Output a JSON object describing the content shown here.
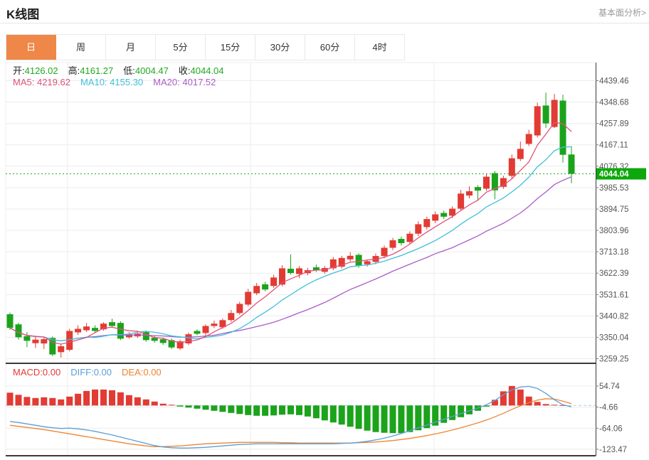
{
  "header": {
    "title": "K线图",
    "link": "基本面分析>"
  },
  "tabs": {
    "items": [
      {
        "name": "tab-day",
        "label": "日",
        "active": true
      },
      {
        "name": "tab-week",
        "label": "周",
        "active": false
      },
      {
        "name": "tab-month",
        "label": "月",
        "active": false
      },
      {
        "name": "tab-5min",
        "label": "5分",
        "active": false
      },
      {
        "name": "tab-15min",
        "label": "15分",
        "active": false
      },
      {
        "name": "tab-30min",
        "label": "30分",
        "active": false
      },
      {
        "name": "tab-60min",
        "label": "60分",
        "active": false
      },
      {
        "name": "tab-4hour",
        "label": "4时",
        "active": false
      }
    ]
  },
  "ohlc": {
    "open_label": "开:",
    "open": "4126.02",
    "high_label": "高:",
    "high": "4161.27",
    "low_label": "低:",
    "low": "4004.47",
    "close_label": "收:",
    "close": "4044.04"
  },
  "ma_info": {
    "ma5_label": "MA5:",
    "ma5": "4219.62",
    "ma10_label": "MA10:",
    "ma10": "4155.30",
    "ma20_label": "MA20:",
    "ma20": "4017.52"
  },
  "macd_info": {
    "macd_label": "MACD:",
    "macd": "0.00",
    "diff_label": "DIFF:",
    "diff": "0.00",
    "dea_label": "DEA:",
    "dea": "0.00"
  },
  "colors": {
    "up": "#e23b33",
    "down": "#1ba31b",
    "ma5": "#e0527a",
    "ma10": "#3fc0d8",
    "ma20": "#a95cc8",
    "diff_line": "#5b9fd8",
    "dea_line": "#ef8532",
    "accent_tab": "#ee8748",
    "price_tag_bg": "#0da80d",
    "price_line": "#28a428",
    "zero_line": "#a9cfe5",
    "grid": "#ececec",
    "axis": "#3a3a3a",
    "tick_text": "#555555",
    "link": "#999999"
  },
  "chart_data": {
    "type": "candlestick",
    "title": "K线图 (daily K-line with MACD sub-chart)",
    "legend_position": "top-left overlay",
    "grid": true,
    "main": {
      "y_ticks": [
        4439.46,
        4348.68,
        4257.89,
        4167.11,
        4076.32,
        3985.53,
        3894.75,
        3803.96,
        3713.18,
        3622.39,
        3531.61,
        3440.82,
        3350.04,
        3259.25
      ],
      "ylim": [
        3240,
        4520
      ],
      "current_price": 4044.04,
      "price_tag": "4044.04",
      "ma_periods": [
        5,
        10,
        20
      ],
      "candle_format": [
        "open",
        "close",
        "low",
        "high"
      ],
      "candles": [
        [
          3448,
          3390,
          3382,
          3455
        ],
        [
          3405,
          3350,
          3340,
          3412
        ],
        [
          3355,
          3335,
          3308,
          3372
        ],
        [
          3325,
          3340,
          3305,
          3356
        ],
        [
          3324,
          3342,
          3300,
          3350
        ],
        [
          3347,
          3277,
          3270,
          3354
        ],
        [
          3287,
          3312,
          3264,
          3320
        ],
        [
          3297,
          3377,
          3290,
          3386
        ],
        [
          3371,
          3386,
          3360,
          3401
        ],
        [
          3380,
          3396,
          3372,
          3411
        ],
        [
          3390,
          3377,
          3370,
          3401
        ],
        [
          3384,
          3408,
          3378,
          3414
        ],
        [
          3414,
          3398,
          3392,
          3429
        ],
        [
          3411,
          3344,
          3338,
          3418
        ],
        [
          3350,
          3363,
          3344,
          3372
        ],
        [
          3354,
          3366,
          3347,
          3374
        ],
        [
          3372,
          3338,
          3331,
          3379
        ],
        [
          3348,
          3335,
          3327,
          3355
        ],
        [
          3342,
          3326,
          3318,
          3349
        ],
        [
          3338,
          3307,
          3300,
          3345
        ],
        [
          3303,
          3333,
          3296,
          3340
        ],
        [
          3324,
          3363,
          3317,
          3370
        ],
        [
          3377,
          3365,
          3358,
          3384
        ],
        [
          3368,
          3398,
          3355,
          3405
        ],
        [
          3398,
          3408,
          3389,
          3421
        ],
        [
          3393,
          3423,
          3386,
          3430
        ],
        [
          3423,
          3453,
          3415,
          3466
        ],
        [
          3453,
          3492,
          3446,
          3501
        ],
        [
          3489,
          3543,
          3481,
          3556
        ],
        [
          3537,
          3568,
          3529,
          3581
        ],
        [
          3575,
          3553,
          3545,
          3586
        ],
        [
          3568,
          3604,
          3560,
          3616
        ],
        [
          3574,
          3643,
          3566,
          3656
        ],
        [
          3641,
          3623,
          3616,
          3702
        ],
        [
          3619,
          3643,
          3601,
          3652
        ],
        [
          3622,
          3635,
          3613,
          3645
        ],
        [
          3647,
          3635,
          3627,
          3659
        ],
        [
          3628,
          3644,
          3620,
          3653
        ],
        [
          3643,
          3681,
          3635,
          3691
        ],
        [
          3650,
          3687,
          3642,
          3696
        ],
        [
          3681,
          3696,
          3672,
          3711
        ],
        [
          3700,
          3655,
          3645,
          3707
        ],
        [
          3660,
          3673,
          3650,
          3680
        ],
        [
          3670,
          3695,
          3660,
          3706
        ],
        [
          3695,
          3730,
          3685,
          3740
        ],
        [
          3730,
          3762,
          3720,
          3772
        ],
        [
          3768,
          3750,
          3740,
          3778
        ],
        [
          3755,
          3790,
          3746,
          3800
        ],
        [
          3790,
          3830,
          3780,
          3842
        ],
        [
          3818,
          3852,
          3808,
          3862
        ],
        [
          3845,
          3872,
          3835,
          3884
        ],
        [
          3878,
          3862,
          3852,
          3888
        ],
        [
          3866,
          3896,
          3856,
          3906
        ],
        [
          3896,
          3960,
          3888,
          3976
        ],
        [
          3952,
          3970,
          3940,
          3991
        ],
        [
          3988,
          3973,
          3930,
          3996
        ],
        [
          3981,
          4032,
          3972,
          4046
        ],
        [
          4047,
          3974,
          3936,
          4056
        ],
        [
          3989,
          4026,
          3980,
          4036
        ],
        [
          4035,
          4110,
          4021,
          4126
        ],
        [
          4107,
          4150,
          4098,
          4181
        ],
        [
          4171,
          4213,
          4162,
          4231
        ],
        [
          4207,
          4331,
          4199,
          4346
        ],
        [
          4334,
          4258,
          4239,
          4389
        ],
        [
          4243,
          4358,
          4238,
          4383
        ],
        [
          4355,
          4125,
          4092,
          4380
        ],
        [
          4126.02,
          4044.04,
          4004.47,
          4161.27
        ]
      ]
    },
    "macd": {
      "y_ticks": [
        54.74,
        -4.66,
        -64.06,
        -123.47
      ],
      "ylim": [
        -135,
        65
      ],
      "histogram": [
        36,
        30,
        24,
        21,
        23,
        21,
        17,
        25,
        33,
        41,
        45,
        45,
        43,
        37,
        29,
        23,
        17,
        11,
        5,
        2,
        -3,
        -6,
        -9,
        -12,
        -15,
        -18,
        -21,
        -24,
        -27,
        -29,
        -29,
        -28,
        -26,
        -25,
        -27,
        -31,
        -36,
        -42,
        -48,
        -54,
        -60,
        -66,
        -71,
        -75,
        -77,
        -78,
        -78,
        -75,
        -70,
        -64,
        -57,
        -49,
        -41,
        -33,
        -25,
        -15,
        -3,
        16,
        40,
        55,
        45,
        25,
        10,
        4,
        2,
        1,
        0
      ],
      "diff": [
        -45,
        -48,
        -52,
        -56,
        -60,
        -63,
        -65,
        -64,
        -66,
        -69,
        -73,
        -78,
        -83,
        -89,
        -95,
        -101,
        -107,
        -113,
        -117,
        -119,
        -120,
        -120,
        -119,
        -118,
        -116,
        -114,
        -112,
        -110,
        -109,
        -108,
        -108,
        -108,
        -108,
        -108,
        -108,
        -108,
        -108,
        -108,
        -108,
        -107,
        -106,
        -104,
        -101,
        -97,
        -92,
        -86,
        -79,
        -71,
        -63,
        -55,
        -47,
        -39,
        -31,
        -23,
        -15,
        -7,
        2,
        14,
        30,
        44,
        52,
        54,
        48,
        34,
        16,
        2,
        -4
      ],
      "dea": [
        -56,
        -59,
        -62,
        -65,
        -68,
        -72,
        -76,
        -80,
        -84,
        -88,
        -92,
        -96,
        -100,
        -104,
        -108,
        -111,
        -114,
        -116,
        -116,
        -115,
        -114,
        -112,
        -110,
        -108,
        -107,
        -106,
        -105,
        -104,
        -104,
        -104,
        -104,
        -104,
        -105,
        -105,
        -106,
        -106,
        -106,
        -106,
        -106,
        -106,
        -106,
        -105,
        -104,
        -103,
        -101,
        -99,
        -96,
        -93,
        -89,
        -85,
        -80,
        -75,
        -69,
        -63,
        -56,
        -49,
        -41,
        -32,
        -22,
        -11,
        -1,
        8,
        15,
        19,
        18,
        12,
        5
      ]
    }
  }
}
